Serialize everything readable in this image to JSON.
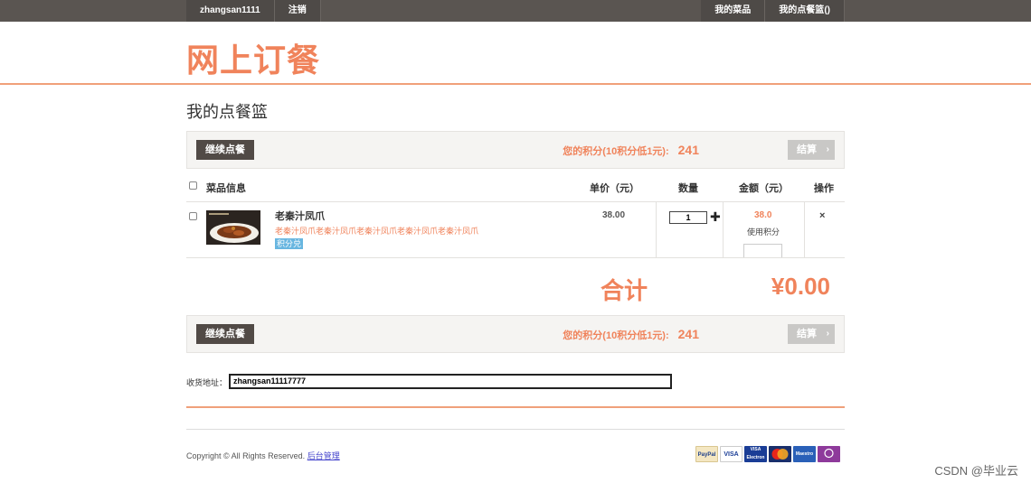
{
  "topbar": {
    "username": "zhangsan1111",
    "logout": "注销",
    "my_dishes": "我的菜品",
    "my_basket": "我的点餐篮",
    "basket_count_open": "(",
    "basket_count": "",
    "basket_count_close": ")"
  },
  "logo": "网上订餐",
  "page_title": "我的点餐篮",
  "action_bar": {
    "continue_label": "继续点餐",
    "points_label": "您的积分(10积分低1元):",
    "points_value": "241",
    "checkout_label": "结算",
    "checkout_arrow": "›"
  },
  "table": {
    "headers": [
      "菜品信息",
      "单价（元）",
      "数量",
      "金额（元）",
      "操作"
    ],
    "rows": [
      {
        "name": "老秦汁凤爪",
        "description": "老秦汁凤爪老秦汁凤爪老秦汁凤爪老秦汁凤爪老秦汁凤爪",
        "tag": "积分兑",
        "unit_price": "38.00",
        "quantity": "1",
        "quantity_plus": "✚",
        "amount": "38.0",
        "use_points": "使用积分",
        "delete": "×"
      }
    ]
  },
  "total": {
    "label": "合计",
    "value": "¥0.00"
  },
  "address": {
    "label": "收货地址：",
    "value": "zhangsan11117777"
  },
  "footer": {
    "copyright": "Copyright © All Rights Reserved.",
    "admin_link": "后台管理",
    "payments": [
      "PayPal",
      "VISA",
      "VISA Electron",
      "",
      "Maestro",
      ""
    ]
  },
  "watermark": "CSDN @毕业云",
  "colors": {
    "accent": "#f0835b",
    "topbar": "#5a5551",
    "dark_button": "#514a46",
    "tag_blue": "#68b6e0"
  }
}
